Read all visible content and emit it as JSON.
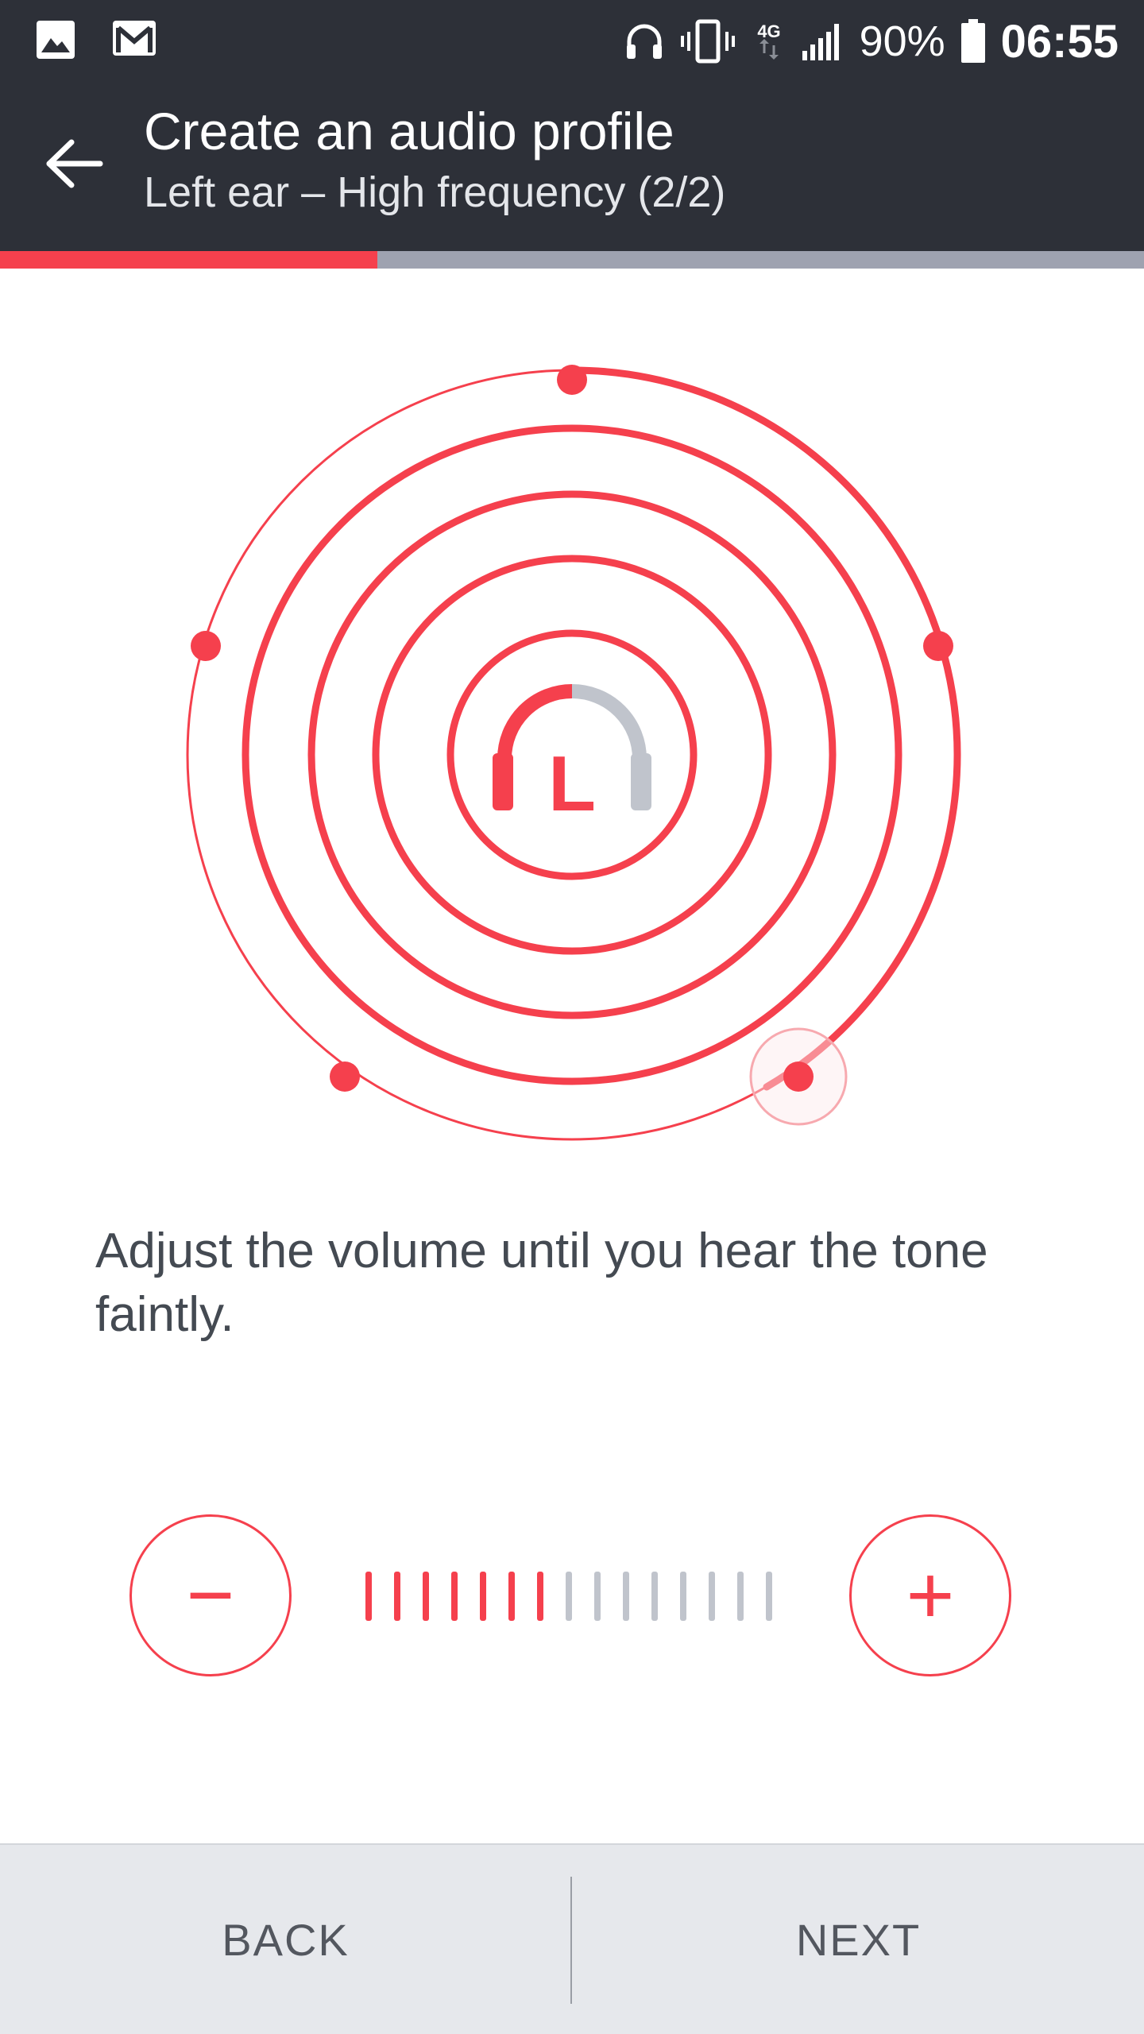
{
  "status_bar": {
    "left_icons": [
      "image-icon",
      "gmail-icon"
    ],
    "right_icons": [
      "headphones-icon",
      "vibrate-icon",
      "network-4g-icon",
      "signal-icon",
      "battery-icon"
    ],
    "network_label": "4G",
    "battery": "90%",
    "time": "06:55"
  },
  "app_bar": {
    "back_icon": "arrow-back-icon",
    "title": "Create an audio profile",
    "subtitle": "Left ear – High frequency (2/2)"
  },
  "progress": {
    "fraction": 0.33
  },
  "visual": {
    "ear_letter": "L",
    "center_icon": "headphones-icon"
  },
  "instruction": "Adjust the volume until you hear the tone faintly.",
  "volume": {
    "minus_label": "−",
    "plus_label": "+",
    "level": 7,
    "max_level": 15
  },
  "bottom_bar": {
    "back_label": "BACK",
    "next_label": "NEXT"
  },
  "colors": {
    "accent": "#f5404d",
    "inactive": "#c0c4cc",
    "bar_bg": "#2d3038"
  }
}
